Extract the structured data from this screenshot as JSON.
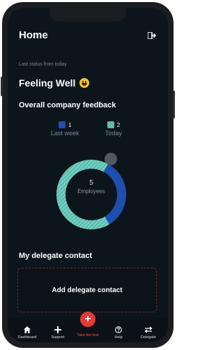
{
  "header": {
    "title": "Home",
    "logout_icon": "logout-icon"
  },
  "status": {
    "caption": "Last status from today",
    "value": "Feeling Well",
    "emoji_icon": "smiley-face-icon"
  },
  "feedback": {
    "title": "Overall company feedback",
    "colors": {
      "last_week": "#1e4fae",
      "today": "#6fcfc1"
    }
  },
  "chart_data": {
    "type": "pie",
    "series": [
      {
        "name": "Last week",
        "value": 1
      },
      {
        "name": "Today",
        "value": 2
      }
    ],
    "legend": [
      {
        "count": "1",
        "label": "Last week"
      },
      {
        "count": "2",
        "label": "Today"
      }
    ],
    "center_value": "5",
    "center_label": "Employees"
  },
  "delegate": {
    "title": "My delegate contact",
    "add_label": "Add delegate contact"
  },
  "tabbar": {
    "items": [
      {
        "label": "Dashboard",
        "icon": "home-icon"
      },
      {
        "label": "Support",
        "icon": "plus-icon"
      },
      {
        "label": "Take the test",
        "icon": "add-fab-icon"
      },
      {
        "label": "Help",
        "icon": "help-icon"
      },
      {
        "label": "Delegate",
        "icon": "swap-arrows-icon"
      }
    ]
  }
}
